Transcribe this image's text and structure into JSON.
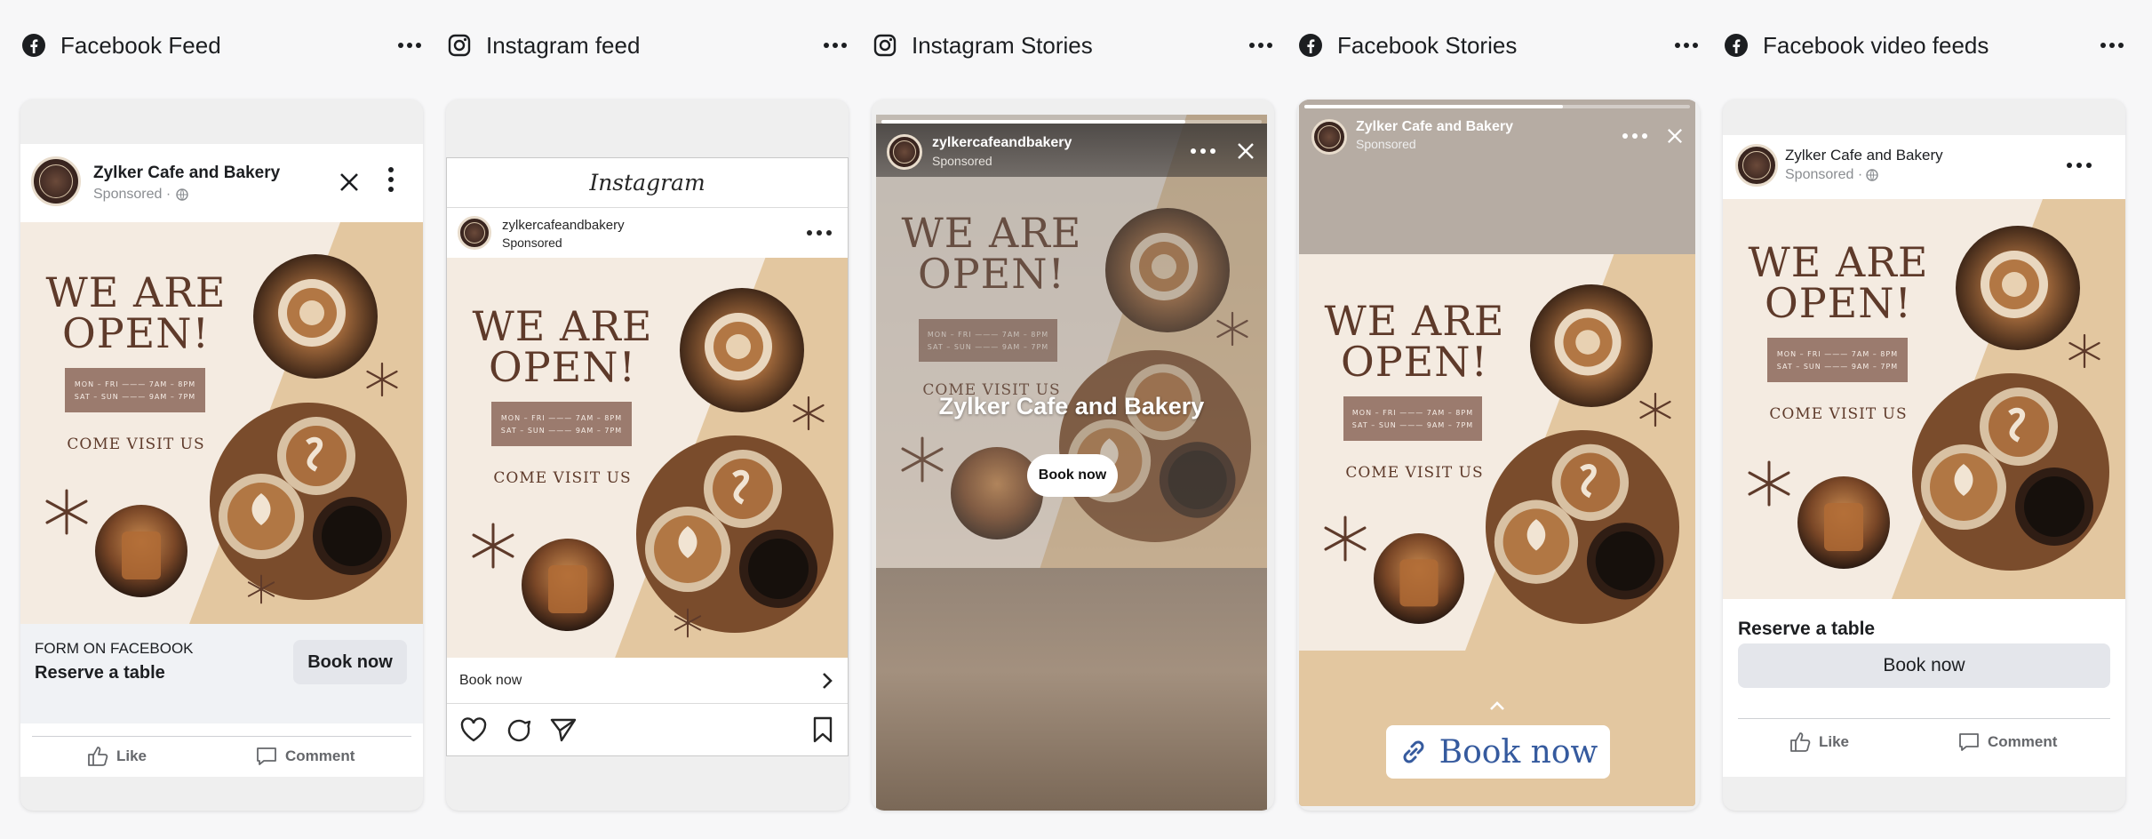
{
  "columns": [
    {
      "title": "Facebook Feed",
      "icon": "facebook-icon"
    },
    {
      "title": "Instagram feed",
      "icon": "instagram-icon"
    },
    {
      "title": "Instagram Stories",
      "icon": "instagram-icon"
    },
    {
      "title": "Facebook Stories",
      "icon": "facebook-icon"
    },
    {
      "title": "Facebook video feeds",
      "icon": "facebook-icon"
    }
  ],
  "creative": {
    "headline_line1": "WE ARE",
    "headline_line2": "OPEN!",
    "hours_line1": "MON – FRI ——— 7AM – 8PM",
    "hours_line2": "SAT – SUN ——— 9AM – 7PM",
    "visit": "COME VISIT US"
  },
  "fb_feed": {
    "page_name": "Zylker Cafe and Bakery",
    "sponsored": "Sponsored ·",
    "form_label": "FORM ON FACEBOOK",
    "cta_title": "Reserve a table",
    "cta_button": "Book now",
    "like": "Like",
    "comment": "Comment"
  },
  "ig_feed": {
    "brand": "Instagram",
    "account": "zylkercafeandbakery",
    "sponsored": "Sponsored",
    "cta": "Book now"
  },
  "ig_stories": {
    "account": "zylkercafeandbakery",
    "sponsored": "Sponsored",
    "overlay_title": "Zylker Cafe and Bakery",
    "cta_button": "Book now",
    "progress": 0.8
  },
  "fb_stories": {
    "page_name": "Zylker Cafe and Bakery",
    "sponsored": "Sponsored",
    "cta_button": "Book now",
    "progress": 0.67
  },
  "fb_video": {
    "page_name": "Zylker Cafe and Bakery",
    "sponsored": "Sponsored ·",
    "cta_title": "Reserve a table",
    "cta_button": "Book now",
    "like": "Like",
    "comment": "Comment"
  },
  "colors": {
    "cream": "#f4ebe1",
    "tan": "#e3c7a0",
    "brown": "#5e3a2a",
    "hours_box": "#9b7b6e"
  }
}
